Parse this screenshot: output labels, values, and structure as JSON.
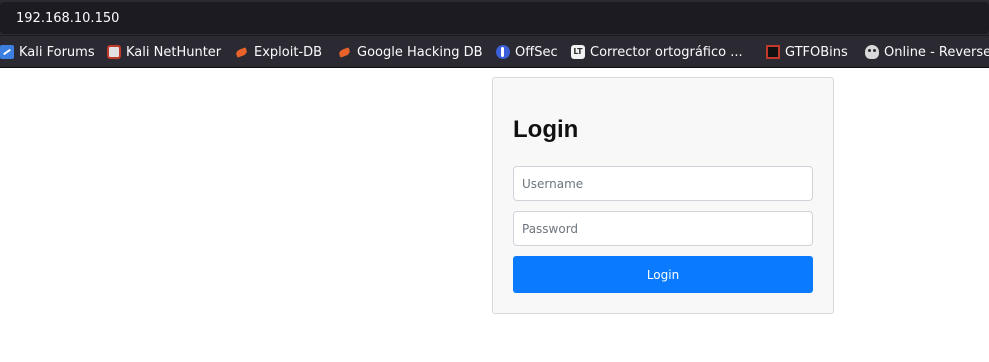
{
  "browser": {
    "url": "192.168.10.150",
    "bookmarks": [
      {
        "label": "Kali Forums",
        "icon": "kali-icon"
      },
      {
        "label": "Kali NetHunter",
        "icon": "nethunter-icon"
      },
      {
        "label": "Exploit-DB",
        "icon": "exploit-db-icon"
      },
      {
        "label": "Google Hacking DB",
        "icon": "exploit-db-icon"
      },
      {
        "label": "OffSec",
        "icon": "offsec-icon"
      },
      {
        "label": "Corrector ortográfico ...",
        "icon": "languagetool-icon"
      },
      {
        "label": "GTFOBins",
        "icon": "gtfobins-icon"
      },
      {
        "label": "Online - Reverse",
        "icon": "skull-icon"
      }
    ]
  },
  "login": {
    "title": "Login",
    "username_placeholder": "Username",
    "password_placeholder": "Password",
    "submit_label": "Login"
  },
  "colors": {
    "button": "#0a7bff",
    "card_background": "#f8f8f8",
    "toolbar": "#2b2a33"
  }
}
